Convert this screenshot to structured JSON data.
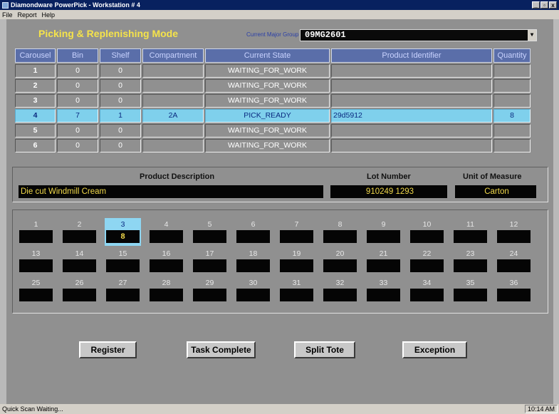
{
  "window": {
    "title": "Diamondware PowerPick - Workstation # 4",
    "controls": {
      "min": "_",
      "max": "▫",
      "close": "x"
    }
  },
  "menu": [
    "File",
    "Report",
    "Help"
  ],
  "mode": {
    "title": "Picking & Replenishing Mode",
    "current_major_group_label": "Current Major Group",
    "current_major_group_value": "09MG2601"
  },
  "table": {
    "columns": [
      "Carousel",
      "Bin",
      "Shelf",
      "Compartment",
      "Current State",
      "Product Identifier",
      "Quantity"
    ],
    "rows": [
      {
        "carousel": "1",
        "bin": "0",
        "shelf": "0",
        "compartment": "",
        "state": "WAITING_FOR_WORK",
        "product": "",
        "quantity": ""
      },
      {
        "carousel": "2",
        "bin": "0",
        "shelf": "0",
        "compartment": "",
        "state": "WAITING_FOR_WORK",
        "product": "",
        "quantity": ""
      },
      {
        "carousel": "3",
        "bin": "0",
        "shelf": "0",
        "compartment": "",
        "state": "WAITING_FOR_WORK",
        "product": "",
        "quantity": ""
      },
      {
        "carousel": "4",
        "bin": "7",
        "shelf": "1",
        "compartment": "2A",
        "state": "PICK_READY",
        "product": "29d5912",
        "quantity": "8"
      },
      {
        "carousel": "5",
        "bin": "0",
        "shelf": "0",
        "compartment": "",
        "state": "WAITING_FOR_WORK",
        "product": "",
        "quantity": ""
      },
      {
        "carousel": "6",
        "bin": "0",
        "shelf": "0",
        "compartment": "",
        "state": "WAITING_FOR_WORK",
        "product": "",
        "quantity": ""
      }
    ]
  },
  "details": {
    "product_description_label": "Product Description",
    "product_description": "Die cut Windmill Cream",
    "lot_number_label": "Lot Number",
    "lot_number": "910249 1293",
    "uom_label": "Unit of Measure",
    "uom": "Carton"
  },
  "tote_cells": [
    {
      "n": "1",
      "v": ""
    },
    {
      "n": "2",
      "v": ""
    },
    {
      "n": "3",
      "v": "8"
    },
    {
      "n": "4",
      "v": ""
    },
    {
      "n": "5",
      "v": ""
    },
    {
      "n": "6",
      "v": ""
    },
    {
      "n": "7",
      "v": ""
    },
    {
      "n": "8",
      "v": ""
    },
    {
      "n": "9",
      "v": ""
    },
    {
      "n": "10",
      "v": ""
    },
    {
      "n": "11",
      "v": ""
    },
    {
      "n": "12",
      "v": ""
    },
    {
      "n": "13",
      "v": ""
    },
    {
      "n": "14",
      "v": ""
    },
    {
      "n": "15",
      "v": ""
    },
    {
      "n": "16",
      "v": ""
    },
    {
      "n": "17",
      "v": ""
    },
    {
      "n": "18",
      "v": ""
    },
    {
      "n": "19",
      "v": ""
    },
    {
      "n": "20",
      "v": ""
    },
    {
      "n": "21",
      "v": ""
    },
    {
      "n": "22",
      "v": ""
    },
    {
      "n": "23",
      "v": ""
    },
    {
      "n": "24",
      "v": ""
    },
    {
      "n": "25",
      "v": ""
    },
    {
      "n": "26",
      "v": ""
    },
    {
      "n": "27",
      "v": ""
    },
    {
      "n": "28",
      "v": ""
    },
    {
      "n": "29",
      "v": ""
    },
    {
      "n": "30",
      "v": ""
    },
    {
      "n": "31",
      "v": ""
    },
    {
      "n": "32",
      "v": ""
    },
    {
      "n": "33",
      "v": ""
    },
    {
      "n": "34",
      "v": ""
    },
    {
      "n": "35",
      "v": ""
    },
    {
      "n": "36",
      "v": ""
    }
  ],
  "selected_tote_cell": "3",
  "buttons": {
    "register": "Register",
    "task_complete": "Task Complete",
    "split_tote": "Split Tote",
    "exception": "Exception"
  },
  "status": {
    "text": "Quick Scan Waiting...",
    "clock": "10:14 AM"
  },
  "colors": {
    "title_bar": "#08215f",
    "header_blue": "#5a6ea9",
    "selected_row": "#7fd0ec",
    "display_text_yellow": "#f0d84a"
  }
}
